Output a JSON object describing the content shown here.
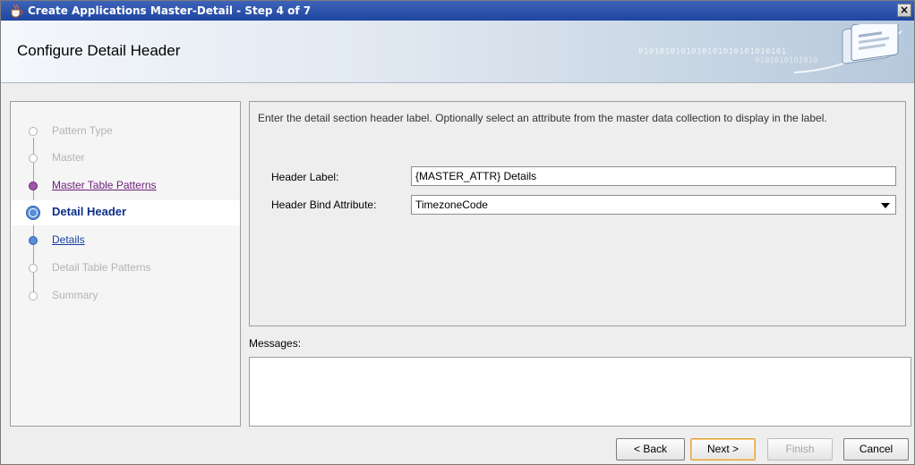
{
  "window": {
    "title": "Create Applications Master-Detail - Step 4 of 7",
    "close_label": "×",
    "icon": "java-cup-icon"
  },
  "banner": {
    "heading": "Configure Detail Header",
    "binary_line1": "0101010101010101010101010101",
    "binary_line2": "0101010101010"
  },
  "steps": [
    {
      "label": "Pattern Type",
      "state": "disabled"
    },
    {
      "label": "Master",
      "state": "disabled"
    },
    {
      "label": "Master Table Patterns",
      "state": "visited"
    },
    {
      "label": "Detail Header",
      "state": "current"
    },
    {
      "label": "Details",
      "state": "link"
    },
    {
      "label": "Detail Table Patterns",
      "state": "disabled"
    },
    {
      "label": "Summary",
      "state": "disabled"
    }
  ],
  "content": {
    "instructions": "Enter the detail section header label.  Optionally select an attribute from the master data collection to display in the label.",
    "header_label": {
      "label": "Header Label:",
      "value": "{MASTER_ATTR} Details"
    },
    "header_bind_attribute": {
      "label": "Header Bind Attribute:",
      "value": "TimezoneCode"
    }
  },
  "messages": {
    "label": "Messages:"
  },
  "buttons": {
    "back": "< Back",
    "next": "Next >",
    "finish": "Finish",
    "cancel": "Cancel"
  }
}
